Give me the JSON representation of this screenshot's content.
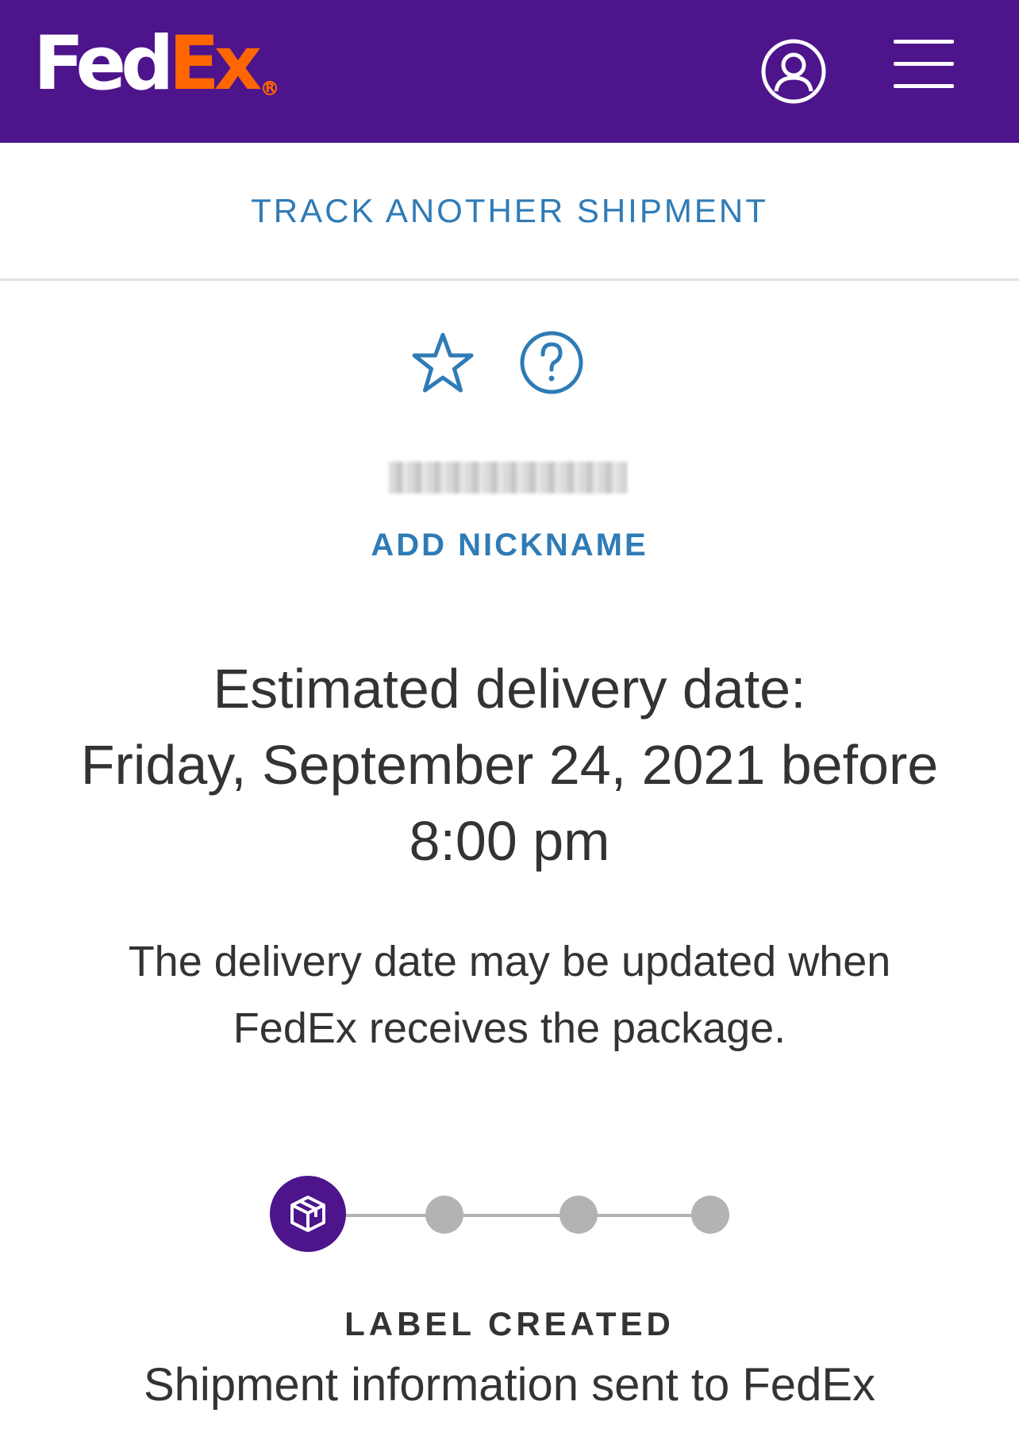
{
  "header": {
    "logo_fed": "Fed",
    "logo_ex": "Ex",
    "logo_reg": "R",
    "brand_color": "#4d148c",
    "accent_color": "#ff6600",
    "account_icon": "user-circle-icon",
    "menu_icon": "hamburger-menu-icon"
  },
  "track_another": {
    "label": "TRACK ANOTHER SHIPMENT"
  },
  "actions": {
    "star_icon": "star-outline-icon",
    "help_icon": "question-circle-icon"
  },
  "shipment": {
    "tracking_number": "582018079843",
    "add_nickname_label": "ADD NICKNAME"
  },
  "delivery": {
    "heading": "Estimated delivery date:",
    "date": "Friday, September 24, 2021 before",
    "time": "8:00 pm",
    "disclaimer": "The delivery date may be updated when FedEx receives the package."
  },
  "progress": {
    "steps_total": 4,
    "current_step": 1,
    "current_icon": "package-box-icon"
  },
  "status": {
    "label": "LABEL CREATED",
    "description": "Shipment information sent to FedEx"
  }
}
